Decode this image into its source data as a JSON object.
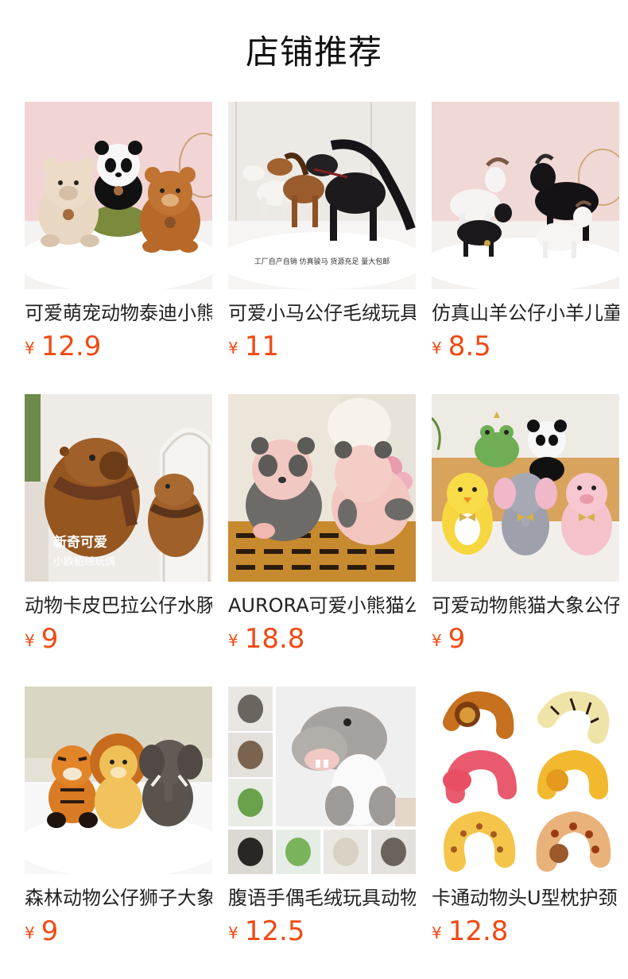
{
  "page": {
    "title": "店铺推荐"
  },
  "currency_symbol": "¥",
  "accent_color": "#f04a14",
  "products": [
    {
      "name": "可爱萌宠动物泰迪小熊",
      "price": "12.9",
      "image": "teddy-bear-panda-plush-photo"
    },
    {
      "name": "可爱小马公仔毛绒玩具",
      "price": "11",
      "image": "horse-plush-photo",
      "image_caption": "工厂自产自销 仿真骏马 货源充足 量大包邮"
    },
    {
      "name": "仿真山羊公仔小羊儿童",
      "price": "8.5",
      "image": "goat-plush-photo"
    },
    {
      "name": "动物卡皮巴拉公仔水豚",
      "price": "9",
      "image": "capybara-plush-photo",
      "image_caption_main": "新奇可爱",
      "image_caption_sub": "小欧貂绒玩偶"
    },
    {
      "name": "AURORA可爱小熊猫公仔",
      "price": "18.8",
      "image": "aurora-panda-plush-photo"
    },
    {
      "name": "可爱动物熊猫大象公仔",
      "price": "9",
      "image": "animal-group-plush-photo"
    },
    {
      "name": "森林动物公仔狮子大象",
      "price": "9",
      "image": "forest-animals-plush-photo"
    },
    {
      "name": "腹语手偶毛绒玩具动物",
      "price": "12.5",
      "image": "hand-puppet-plush-photo"
    },
    {
      "name": "卡通动物头U型枕护颈",
      "price": "12.8",
      "image": "u-pillow-plush-photo"
    }
  ]
}
